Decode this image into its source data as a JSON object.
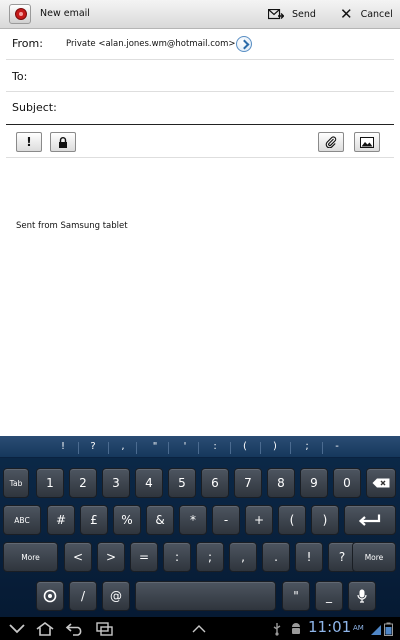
{
  "action_bar": {
    "title": "New email",
    "send_label": "Send",
    "cancel_label": "Cancel",
    "cancel_glyph": "✕"
  },
  "fields": {
    "from_label": "From:",
    "from_value": "Private <alan.jones.wm@hotmail.com>",
    "to_label": "To:",
    "to_value": "",
    "subject_label": "Subject:",
    "subject_value": ""
  },
  "format_toolbar": {
    "priority_glyph": "!"
  },
  "body": {
    "signature": "Sent from Samsung tablet"
  },
  "keyboard": {
    "suggestions": [
      "!",
      "?",
      ",",
      "\"",
      "'",
      ":",
      "(",
      ")",
      ";",
      "-"
    ],
    "row1": [
      "Tab",
      "1",
      "2",
      "3",
      "4",
      "5",
      "6",
      "7",
      "8",
      "9",
      "0"
    ],
    "row2": [
      "ABC",
      "#",
      "£",
      "%",
      "&",
      "*",
      "-",
      "+",
      "(",
      ")"
    ],
    "row3": [
      "More",
      "<",
      ">",
      "=",
      ":",
      ";",
      ",",
      ".",
      "!",
      "?",
      "More"
    ],
    "row4": [
      "/",
      "@",
      "\"",
      "_"
    ]
  },
  "status_bar": {
    "time": "11:01",
    "ampm": "AM"
  },
  "colors": {
    "keyboard_bg": "#0c2a4a",
    "key_face": "#3e454e",
    "clock": "#8fb6ea"
  }
}
